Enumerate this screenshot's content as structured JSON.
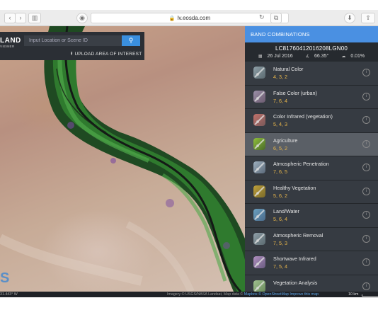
{
  "browser": {
    "url": "lv.eosda.com",
    "back_icon": "chevron-left-icon",
    "forward_icon": "chevron-right-icon"
  },
  "map": {
    "brand": "LAND",
    "brand_sub": "VIEWER",
    "search_placeholder": "Input Location or Scene ID",
    "upload_label": "UPLOAD AREA OF INTEREST",
    "big_letter": "S",
    "coords": "31.443° W",
    "attribution_prefix": "Imagery © USGS/NASA Landsat, Map data © ",
    "attribution_links": "Mapbox © OpenStreetMap Improve this map",
    "scale": "10 km"
  },
  "panel": {
    "title": "BAND COMBINATIONS",
    "scene_id": "LC81760412016208LGN00",
    "date": "26 Jul 2016",
    "sun_angle": "66.35°",
    "cloud": "0.01%",
    "combinations": [
      {
        "name": "Natural Color",
        "bands": "4, 3, 2",
        "selected": false
      },
      {
        "name": "False Color (urban)",
        "bands": "7, 6, 4",
        "selected": false
      },
      {
        "name": "Color Infrared (vegetation)",
        "bands": "5, 4, 3",
        "selected": false
      },
      {
        "name": "Agriculture",
        "bands": "6, 5, 2",
        "selected": true
      },
      {
        "name": "Atmospheric Penetration",
        "bands": "7, 6, 5",
        "selected": false
      },
      {
        "name": "Healthy Vegetation",
        "bands": "5, 6, 2",
        "selected": false
      },
      {
        "name": "Land/Water",
        "bands": "5, 6, 4",
        "selected": false
      },
      {
        "name": "Atmospheric Removal",
        "bands": "7, 5, 3",
        "selected": false
      },
      {
        "name": "Shortwave Infrared",
        "bands": "7, 5, 4",
        "selected": false
      },
      {
        "name": "Vegetation Analysis",
        "bands": "",
        "selected": false
      }
    ]
  }
}
